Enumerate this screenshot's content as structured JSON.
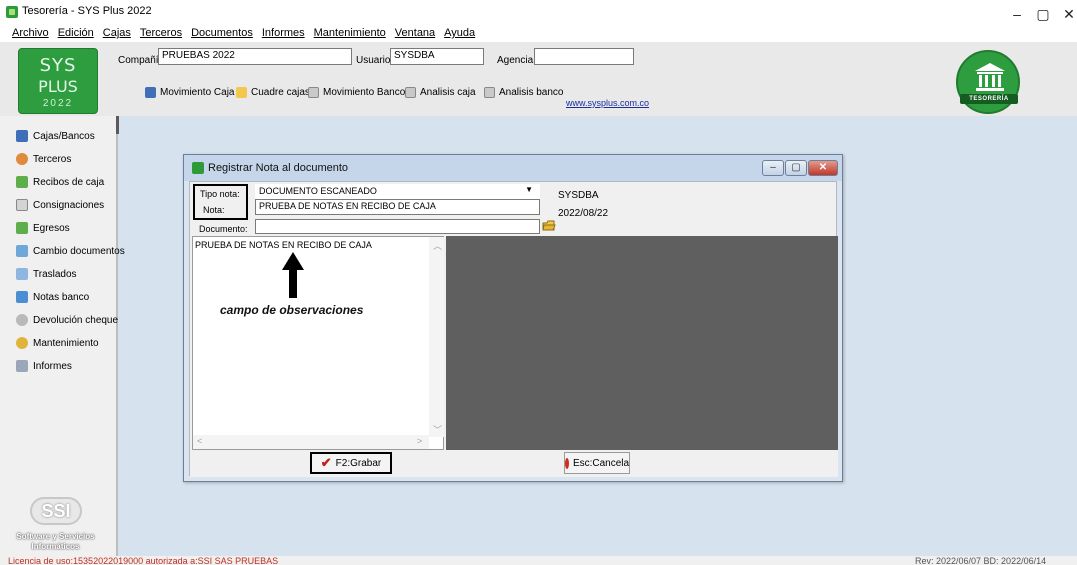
{
  "window": {
    "title": "Tesorería - SYS Plus 2022",
    "controls": [
      "–",
      "▢",
      "✕"
    ]
  },
  "menu": [
    "Archivo",
    "Edición",
    "Cajas",
    "Terceros",
    "Documentos",
    "Informes",
    "Mantenimiento",
    "Ventana",
    "Ayuda"
  ],
  "logo": {
    "line1": "SYS",
    "line2": "PLUS",
    "line3": "2022"
  },
  "header": {
    "compania_label": "Compañía:",
    "compania_value": "PRUEBAS 2022",
    "usuario_label": "Usuario:",
    "usuario_value": "SYSDBA",
    "agencia_label": "Agencia:",
    "agencia_value": "",
    "toolbar": [
      "Movimiento Caja",
      "Cuadre cajas",
      "Movimiento Banco",
      "Analisis caja",
      "Analisis banco"
    ],
    "link": "www.sysplus.com.co",
    "badge_text": "TESORERÍA"
  },
  "sidebar": {
    "items": [
      {
        "label": "Cajas/Bancos",
        "icon": "cash-box-icon"
      },
      {
        "label": "Terceros",
        "icon": "person-icon"
      },
      {
        "label": "Recibos de caja",
        "icon": "receipt-icon"
      },
      {
        "label": "Consignaciones",
        "icon": "document-icon"
      },
      {
        "label": "Egresos",
        "icon": "expense-icon"
      },
      {
        "label": "Cambio documentos",
        "icon": "exchange-icon"
      },
      {
        "label": "Traslados",
        "icon": "transfer-icon"
      },
      {
        "label": "Notas banco",
        "icon": "bank-note-icon"
      },
      {
        "label": "Devolución cheque",
        "icon": "return-check-icon"
      },
      {
        "label": "Mantenimiento",
        "icon": "maintenance-icon"
      },
      {
        "label": "Informes",
        "icon": "printer-icon"
      }
    ],
    "ssi_mark": "SSI",
    "ssi_line1": "Software y Servicios",
    "ssi_line2": "Informáticos"
  },
  "dialog": {
    "title": "Registrar Nota al documento",
    "tipo_nota_label": "Tipo nota:",
    "tipo_nota_value": "DOCUMENTO ESCANEADO",
    "nota_label": "Nota:",
    "nota_value": "PRUEBA DE NOTAS EN RECIBO DE CAJA",
    "documento_label": "Documento:",
    "documento_value": "",
    "user": "SYSDBA",
    "date": "2022/08/22",
    "observaciones_text": "PRUEBA DE NOTAS EN RECIBO DE CAJA",
    "save_label": "F2:Grabar",
    "cancel_label": "Esc:Cancela"
  },
  "annotation": "campo de observaciones",
  "status": {
    "left": "Licencia de uso:15352022019000 autorizada a:SSI SAS PRUEBAS",
    "right": "Rev: 2022/06/07 BD: 2022/06/14"
  },
  "colors": {
    "brand_green": "#2e9d3f",
    "workspace": "#d6e2ee",
    "license_text": "#c0301f"
  }
}
